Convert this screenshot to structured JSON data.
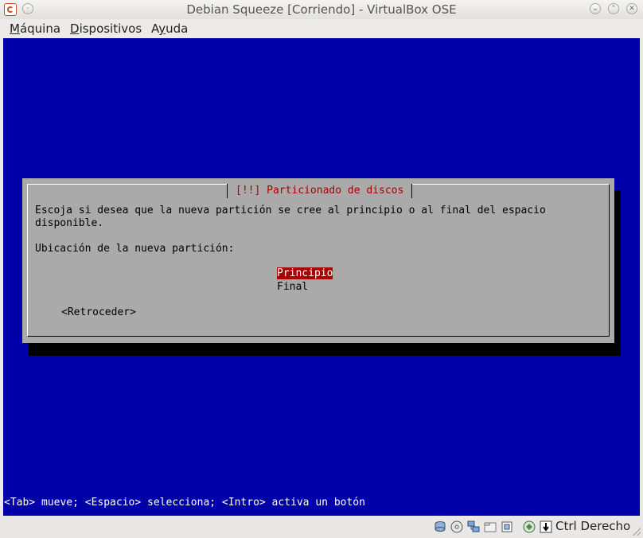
{
  "window": {
    "title": "Debian Squeeze [Corriendo] - VirtualBox OSE",
    "icons": [
      "virtualbox-app-icon",
      "minimize-icon",
      "restore-icon",
      "close-icon"
    ]
  },
  "menu": {
    "items": [
      {
        "accel": "M",
        "rest": "áquina"
      },
      {
        "accel": "D",
        "rest": "ispositivos"
      },
      {
        "accel": "y",
        "pre": "A",
        "rest": "uda"
      }
    ]
  },
  "vm": {
    "dialog": {
      "title": "[!!] Particionado de discos",
      "line1": "Escoja si desea que la nueva partición se cree al principio o al final del espacio",
      "line2": "disponible.",
      "prompt": "Ubicación de la nueva partición:",
      "options": [
        "Principio",
        "Final"
      ],
      "selected_option": "Principio",
      "back_button": "<Retroceder>"
    },
    "hint": "<Tab> mueve; <Espacio> selecciona; <Intro> activa un botón",
    "colors": {
      "background": "#0000a8",
      "dialog": "#aaaaaa",
      "title": "#a80000",
      "selection": "#a80000"
    }
  },
  "statusbar": {
    "host_key": "Ctrl Derecho",
    "icons": [
      "hard-disk-icon",
      "cd-dvd-icon",
      "network-icon",
      "shared-folders-icon",
      "usb-icon",
      "display-icon",
      "mouse-integration-icon",
      "host-key-icon"
    ]
  }
}
